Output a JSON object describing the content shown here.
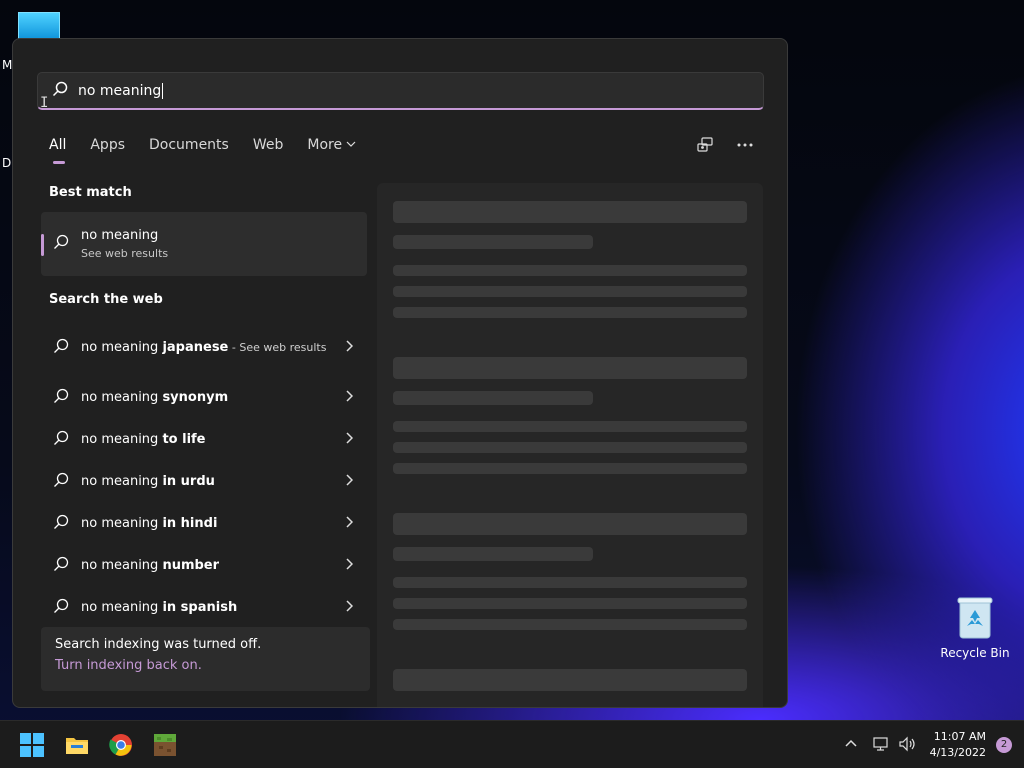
{
  "desktop": {
    "left_letters": [
      "M",
      "Da"
    ],
    "recycle_bin_label": "Recycle Bin"
  },
  "search": {
    "query": "no meaning",
    "tabs": [
      {
        "label": "All",
        "active": true
      },
      {
        "label": "Apps"
      },
      {
        "label": "Documents"
      },
      {
        "label": "Web"
      },
      {
        "label": "More"
      }
    ],
    "best_match": {
      "section_title": "Best match",
      "title": "no meaning",
      "subtitle": "See web results"
    },
    "web": {
      "section_title": "Search the web",
      "items": [
        {
          "prefix": "no meaning ",
          "bold": "japanese",
          "suffix": " - See web results"
        },
        {
          "prefix": "no meaning ",
          "bold": "synonym"
        },
        {
          "prefix": "no meaning ",
          "bold": "to life"
        },
        {
          "prefix": "no meaning ",
          "bold": "in urdu"
        },
        {
          "prefix": "no meaning ",
          "bold": "in hindi"
        },
        {
          "prefix": "no meaning ",
          "bold": "number"
        },
        {
          "prefix": "no meaning ",
          "bold": "in spanish"
        }
      ]
    },
    "index_note": {
      "line1": "Search indexing was turned off.",
      "line2": "Turn indexing back on."
    }
  },
  "taskbar": {
    "time": "11:07 AM",
    "date": "4/13/2022",
    "notification_count": "2"
  },
  "icons": {
    "search": "search-icon",
    "chevron_right": "chevron-right-icon",
    "more": "ellipsis-icon",
    "feedback": "feedback-icon"
  },
  "colors": {
    "accent": "#c69ad6",
    "panel_bg": "#202020"
  }
}
